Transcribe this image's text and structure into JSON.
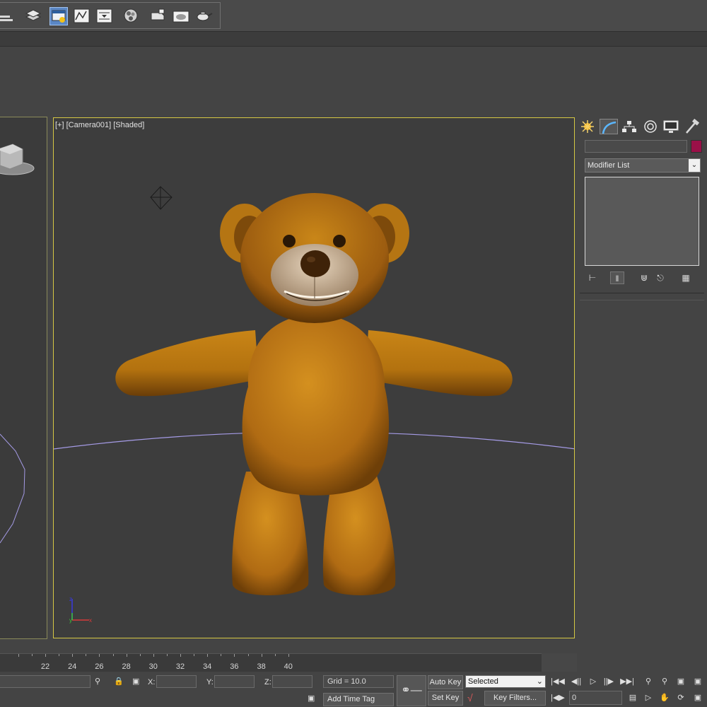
{
  "viewport": {
    "label": "[+] [Camera001] [Shaded]"
  },
  "command_panel": {
    "tabs": [
      "create",
      "modify",
      "hierarchy",
      "motion",
      "display",
      "utilities"
    ],
    "active_tab": "modify",
    "name_value": "",
    "object_color": "#9a1048",
    "modifier_list": "Modifier List"
  },
  "timeline": {
    "ticks": [
      "22",
      "24",
      "26",
      "28",
      "30",
      "32",
      "34",
      "36",
      "38",
      "40"
    ]
  },
  "status": {
    "x_label": "X:",
    "y_label": "Y:",
    "z_label": "Z:",
    "x_value": "",
    "y_value": "",
    "z_value": "",
    "grid": "Grid = 10.0",
    "add_time_tag": "Add Time Tag",
    "auto_key": "Auto Key",
    "set_key": "Set Key",
    "selected": "Selected",
    "key_filters": "Key Filters...",
    "frame": "0"
  }
}
